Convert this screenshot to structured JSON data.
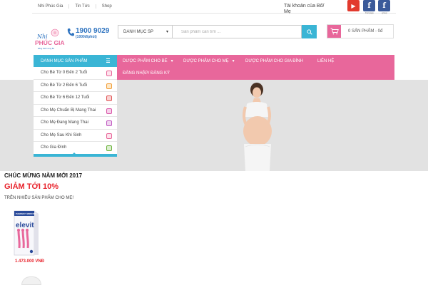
{
  "topbar": {
    "links": [
      "Nhi Phúc Gia",
      "Tin Tức",
      "Shop"
    ],
    "account": "Tài khoản của Bố/ Mẹ",
    "social": [
      {
        "name": "youtube-icon",
        "glyph": "▶",
        "caption": "Youtube"
      },
      {
        "name": "facebook-icon",
        "glyph": "f",
        "caption": "Fanpage"
      },
      {
        "name": "facebook-group-icon",
        "glyph": "f",
        "caption": "group"
      }
    ]
  },
  "header": {
    "logo": {
      "line1": "Nhi",
      "line2": "PHÚC GIA",
      "tagline": "Đồng hành cùng Bé"
    },
    "hotline": {
      "number": "1900 9029",
      "sub": "(1000đ/phút)"
    },
    "category_select": "DANH MỤC SP",
    "search_placeholder": "Sản phẩm cần tìm ...",
    "cart_label": "0 SẢN PHẨM - 0đ"
  },
  "nav": {
    "category_header": "DANH MỤC SẢN PHẨM",
    "items": [
      {
        "label": "DƯỢC PHẨM CHO BÉ",
        "caret": "▼"
      },
      {
        "label": "DƯỢC PHẨM CHO MẸ",
        "caret": "▼"
      },
      {
        "label": "DƯỢC PHẨM CHO GIA ĐÌNH",
        "caret": ""
      },
      {
        "label": "LIÊN HỆ",
        "caret": ""
      },
      {
        "label": "ĐĂNG NHẬP/ ĐĂNG KÝ",
        "caret": ""
      }
    ]
  },
  "sidebar": {
    "items": [
      {
        "label": "Cho Bé Từ 0 Đến 2 Tuổi",
        "icon": "baby-bottle-icon",
        "color": "#e8679b"
      },
      {
        "label": "Cho Bé Từ 2 Đến 6 Tuổi",
        "icon": "toddler-icon",
        "color": "#f2a03c"
      },
      {
        "label": "Cho Bé Từ 6 Đến 12 Tuổi",
        "icon": "child-icon",
        "color": "#e05a5a"
      },
      {
        "label": "Cho Mẹ Chuẩn Bị Mang Thai",
        "icon": "mother-icon",
        "color": "#d957a8"
      },
      {
        "label": "Cho Mẹ Đang Mang Thai",
        "icon": "pregnant-icon",
        "color": "#c25bc2"
      },
      {
        "label": "Cho Mẹ Sau Khi Sinh",
        "icon": "newborn-icon",
        "color": "#e8679b"
      },
      {
        "label": "Cho Gia Đình",
        "icon": "family-icon",
        "color": "#6cb33f"
      }
    ]
  },
  "promo": {
    "line1": "CHÚC MỪNG NĂM MỚI 2017",
    "line2": "GIẢM TỚI 10%",
    "line3": "TRÊN NHIỀU SẢN PHẨM CHO MẸ!"
  },
  "products": [
    {
      "brand": "elevit",
      "top_text": "PHARMACY MEDICINE",
      "price": "1.473.000 VNĐ"
    }
  ],
  "colors": {
    "accent_blue": "#3ab5d5",
    "accent_pink": "#e8679b",
    "sale_red": "#e8212a"
  }
}
